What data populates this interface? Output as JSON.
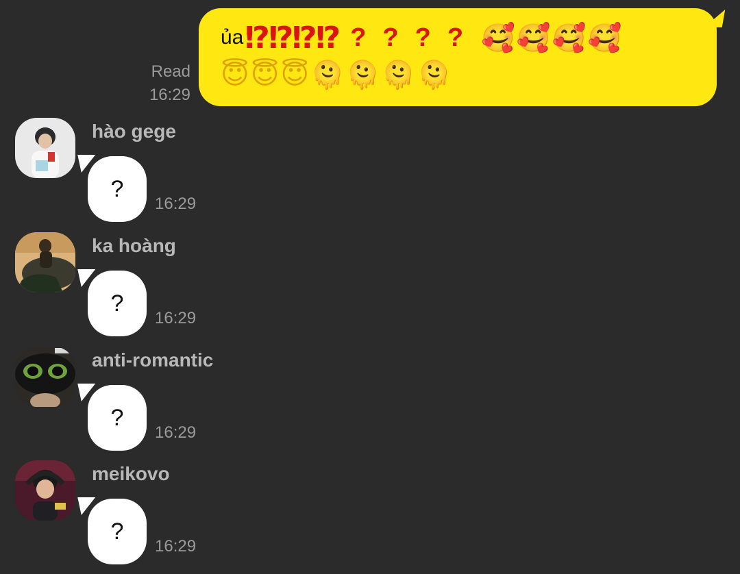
{
  "outgoing": {
    "read_label": "Read",
    "time": "16:29",
    "prefix": "ủa",
    "marks": "⁉⁉⁉⁉",
    "questions": "????",
    "emoji_row1": "🥰🥰🥰🥰",
    "emoji_row2_halo": "😇😇😇",
    "emoji_row2_melt": "🫠🫠🫠🫠",
    "bubble_color": "#ffe812"
  },
  "messages": [
    {
      "sender": "hào gege",
      "text": "?",
      "time": "16:29",
      "avatar": "avatar-photo"
    },
    {
      "sender": "ka hoàng",
      "text": "?",
      "time": "16:29",
      "avatar": "avatar-photo"
    },
    {
      "sender": "anti-romantic",
      "text": "?",
      "time": "16:29",
      "avatar": "avatar-photo"
    },
    {
      "sender": "meikovo",
      "text": "?",
      "time": "16:29",
      "avatar": "avatar-photo"
    }
  ],
  "colors": {
    "background": "#2b2b2b",
    "incoming_bubble": "#ffffff",
    "accent_red": "#d9160d"
  }
}
